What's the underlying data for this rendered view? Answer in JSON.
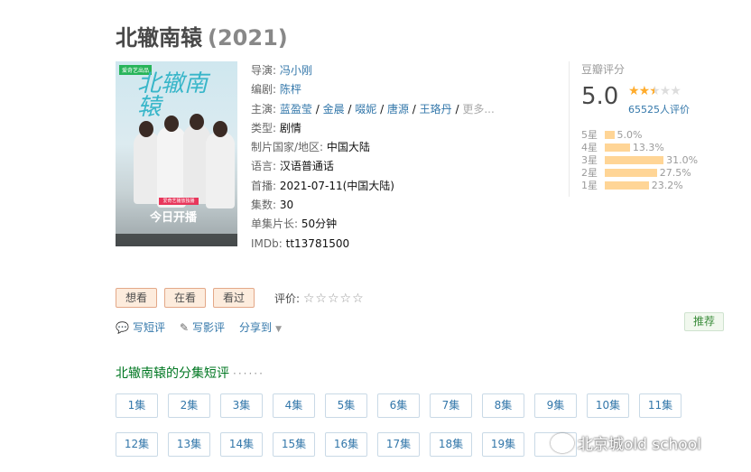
{
  "page": {
    "title": "北辙南辕",
    "year": "(2021)"
  },
  "poster": {
    "badge": "爱奇艺出品",
    "title": "北辙南辕",
    "strip": "爱奇艺播放独播",
    "opening": "今日开播"
  },
  "info": {
    "director_label": "导演:",
    "director": "冯小刚",
    "writer_label": "编剧:",
    "writer": "陈枰",
    "cast_label": "主演:",
    "cast": [
      "蓝盈莹",
      "金晨",
      "啜妮",
      "唐源",
      "王珞丹"
    ],
    "cast_more": "更多...",
    "genre_label": "类型:",
    "genre": "剧情",
    "country_label": "制片国家/地区:",
    "country": "中国大陆",
    "language_label": "语言:",
    "language": "汉语普通话",
    "premiere_label": "首播:",
    "premiere": "2021-07-11(中国大陆)",
    "episodes_label": "集数:",
    "episodes": "30",
    "runtime_label": "单集片长:",
    "runtime": "50分钟",
    "imdb_label": "IMDb:",
    "imdb": "tt13781500"
  },
  "rating": {
    "title": "豆瓣评分",
    "score": "5.0",
    "votes": "65525人评价",
    "stars_value": 2.5,
    "star_color": "#ffac2d",
    "distribution": [
      {
        "label": "5星",
        "percent": "5.0%",
        "value": 5.0
      },
      {
        "label": "4星",
        "percent": "13.3%",
        "value": 13.3
      },
      {
        "label": "3星",
        "percent": "31.0%",
        "value": 31.0
      },
      {
        "label": "2星",
        "percent": "27.5%",
        "value": 27.5
      },
      {
        "label": "1星",
        "percent": "23.2%",
        "value": 23.2
      }
    ]
  },
  "buttons": {
    "want": "想看",
    "watching": "在看",
    "watched": "看过",
    "my_rating_label": "评价:",
    "my_rating_stars": "☆☆☆☆☆"
  },
  "actions": {
    "short_review": "写短评",
    "review": "写影评",
    "share": "分享到",
    "recommend": "推荐"
  },
  "episodes_section": {
    "title": "北辙南辕的分集短评",
    "dots": "······",
    "items": [
      "1集",
      "2集",
      "3集",
      "4集",
      "5集",
      "6集",
      "7集",
      "8集",
      "9集",
      "10集",
      "11集",
      "12集",
      "13集",
      "14集",
      "15集",
      "16集",
      "17集",
      "18集",
      "19集"
    ]
  },
  "watermark": {
    "text": "北京城old school"
  }
}
